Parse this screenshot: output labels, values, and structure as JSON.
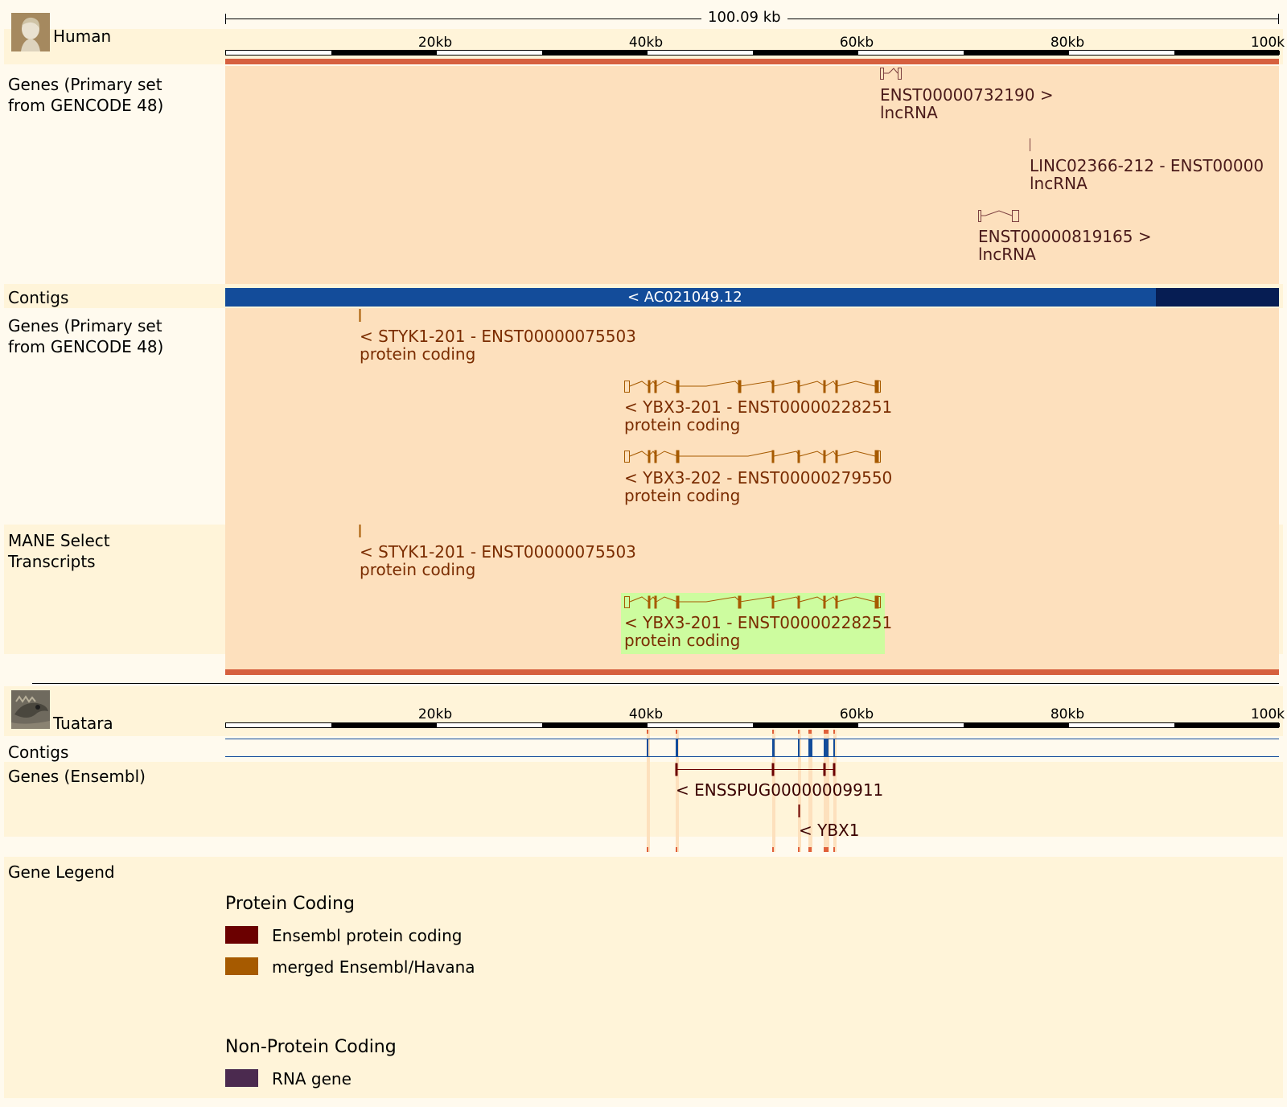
{
  "colors": {
    "page_bg": "#fffaee",
    "band_bg": "#fff4d9",
    "human_region": "#fde0bd",
    "region_border": "#d6603f",
    "contig_blue": "#134c9a",
    "contig_dark": "#061d53",
    "merged_gene": "#a65a00",
    "ensembl_gene": "#6b0000",
    "rna_gene": "#4b2a4f",
    "lncrna": "#7d4040",
    "highlight": "#cdfc9f"
  },
  "scale": {
    "span_label": "100.09 kb",
    "ticks": [
      "20kb",
      "40kb",
      "60kb",
      "80kb",
      "100k"
    ]
  },
  "human": {
    "species": "Human",
    "avatar": "human-bust-icon",
    "tracks": {
      "genes_top_label": "Genes (Primary set\nfrom GENCODE 48)",
      "contigs_label": "Contigs",
      "genes_bottom_label": "Genes (Primary set\nfrom GENCODE 48)",
      "mane_label": "MANE Select\nTranscripts"
    },
    "contig_name": "< AC021049.12",
    "genes_top": [
      {
        "name": "ENST00000732190 >",
        "biotype": "lncRNA"
      },
      {
        "name": "LINC02366-212 - ENST00000",
        "biotype": "lncRNA"
      },
      {
        "name": "ENST00000819165 >",
        "biotype": "lncRNA"
      }
    ],
    "genes_bottom": [
      {
        "name": "< STYK1-201 - ENST00000075503",
        "biotype": "protein coding"
      },
      {
        "name": "< YBX3-201 - ENST00000228251",
        "biotype": "protein coding"
      },
      {
        "name": "< YBX3-202 - ENST00000279550",
        "biotype": "protein coding"
      }
    ],
    "mane": [
      {
        "name": "< STYK1-201 - ENST00000075503",
        "biotype": "protein coding"
      },
      {
        "name": "< YBX3-201 - ENST00000228251",
        "biotype": "protein coding"
      }
    ]
  },
  "tuatara": {
    "species": "Tuatara",
    "avatar": "tuatara-lizard-icon",
    "tracks": {
      "contigs_label": "Contigs",
      "genes_label": "Genes (Ensembl)"
    },
    "genes": [
      {
        "name": "< ENSSPUG00000009911"
      },
      {
        "name": "< YBX1"
      }
    ]
  },
  "legend": {
    "title": "Gene Legend",
    "sections": [
      {
        "title": "Protein Coding",
        "items": [
          {
            "label": "Ensembl protein coding",
            "color": "#6b0000"
          },
          {
            "label": "merged Ensembl/Havana",
            "color": "#a65a00"
          }
        ]
      },
      {
        "title": "Non-Protein Coding",
        "items": [
          {
            "label": "RNA gene",
            "color": "#4b2a4f"
          }
        ]
      }
    ]
  }
}
